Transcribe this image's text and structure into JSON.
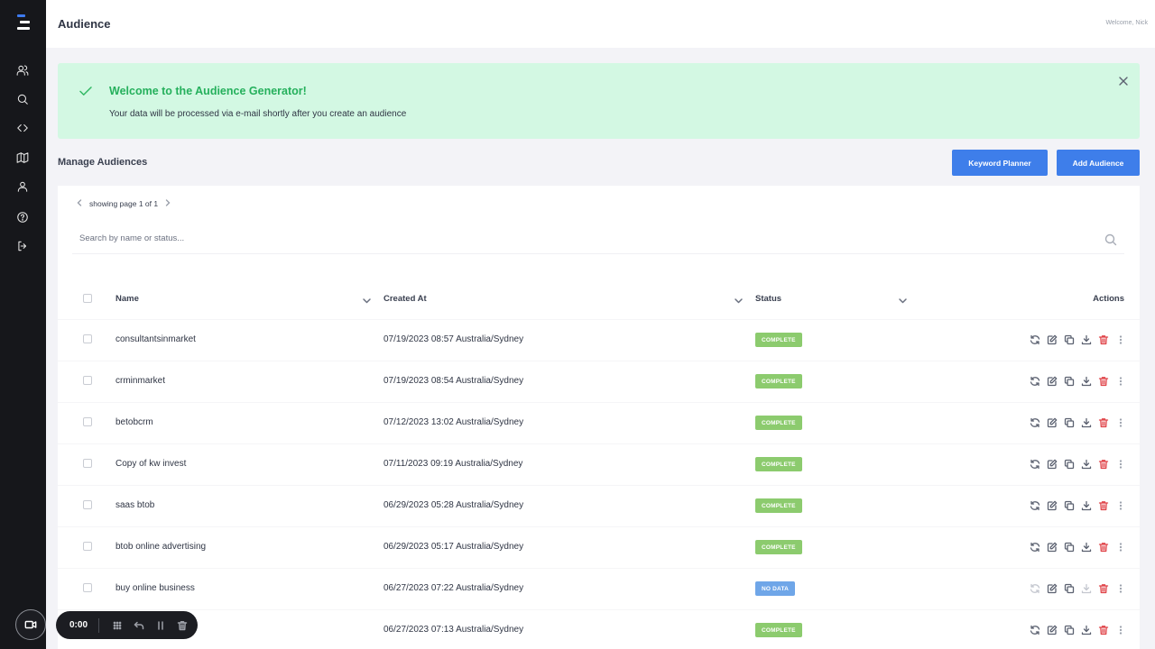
{
  "header": {
    "title": "Audience",
    "welcome": "Welcome, Nick"
  },
  "alert": {
    "title": "Welcome to the Audience Generator!",
    "body": "Your data will be processed via e-mail shortly after you create an audience"
  },
  "manage": {
    "title": "Manage Audiences",
    "keyword_planner_label": "Keyword Planner",
    "add_audience_label": "Add Audience"
  },
  "pager": {
    "text": "showing page 1 of 1"
  },
  "search": {
    "placeholder": "Search by name or status..."
  },
  "table": {
    "headers": {
      "name": "Name",
      "created": "Created At",
      "status": "Status",
      "actions": "Actions"
    },
    "rows": [
      {
        "name": "consultantsinmarket",
        "created": "07/19/2023 08:57 Australia/Sydney",
        "status": "COMPLETE"
      },
      {
        "name": "crminmarket",
        "created": "07/19/2023 08:54 Australia/Sydney",
        "status": "COMPLETE"
      },
      {
        "name": "betobcrm",
        "created": "07/12/2023 13:02 Australia/Sydney",
        "status": "COMPLETE"
      },
      {
        "name": "Copy of kw invest",
        "created": "07/11/2023 09:19 Australia/Sydney",
        "status": "COMPLETE"
      },
      {
        "name": "saas btob",
        "created": "06/29/2023 05:28 Australia/Sydney",
        "status": "COMPLETE"
      },
      {
        "name": "btob online advertising",
        "created": "06/29/2023 05:17 Australia/Sydney",
        "status": "COMPLETE"
      },
      {
        "name": "buy online business",
        "created": "06/27/2023 07:22 Australia/Sydney",
        "status": "NO DATA"
      },
      {
        "name": "",
        "created": "06/27/2023 07:13 Australia/Sydney",
        "status": "COMPLETE"
      }
    ]
  },
  "recorder": {
    "time": "0:00"
  },
  "colors": {
    "accent": "#3e7eea",
    "status_complete": "#8ccb6e",
    "status_no_data": "#6fa6e8",
    "alert_bg": "#d3f8e3",
    "alert_title": "#25b05c",
    "sidebar_bg": "#16171b"
  },
  "icons": {
    "sidebar": [
      "users-icon",
      "search-icon",
      "code-icon",
      "map-icon",
      "user-icon",
      "help-icon",
      "logout-icon"
    ],
    "row_actions": [
      "refresh-icon",
      "edit-icon",
      "copy-icon",
      "download-icon",
      "trash-icon",
      "more-icon"
    ]
  }
}
